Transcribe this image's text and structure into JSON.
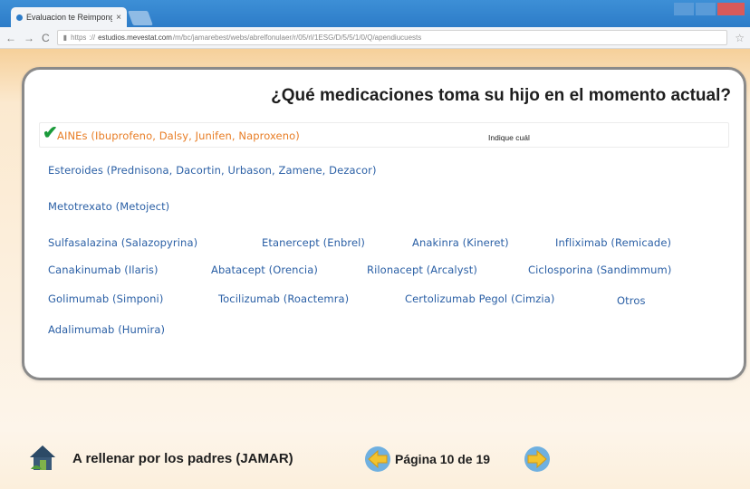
{
  "browser": {
    "tab_title": "Evaluacion te Reimpong",
    "tab_close": "×",
    "nav": {
      "back": "←",
      "forward": "→",
      "reload": "C"
    },
    "url_scheme": "https",
    "url_host": "estudios.mevestat.com",
    "url_path": "/m/bc/jamarebest/webs/abrelfonulaer/r/05/rl/1ESG/D/5/5/1/0/Q/apendiucuests"
  },
  "question": {
    "title": "¿Qué medicaciones toma su hijo en el momento actual?",
    "selected_option": "AINEs (Ibuprofeno, Dalsy, Junifen, Naproxeno)",
    "indique_label": "Indique cuál",
    "options": [
      "Esteroides (Prednisona, Dacortin, Urbason, Zamene, Dezacor)",
      "Metotrexato (Metoject)",
      "Sulfasalazina (Salazopyrina)",
      "Etanercept (Enbrel)",
      "Anakinra (Kineret)",
      "Infliximab (Remicade)",
      "Canakinumab (Ilaris)",
      "Abatacept (Orencia)",
      "Rilonacept (Arcalyst)",
      "Ciclosporina (Sandimmum)",
      "Golimumab (Simponi)",
      "Tocilizumab (Roactemra)",
      "Certolizumab Pegol (Cimzia)",
      "Otros",
      "Adalimumab (Humira)"
    ]
  },
  "footer": {
    "label": "A rellenar por los padres (JAMAR)",
    "page_indicator": "Página 10 de 19",
    "icons": {
      "home": "house-icon",
      "prev": "arrow-left-icon",
      "next": "arrow-right-icon"
    }
  },
  "colors": {
    "accent_selected": "#e87d25",
    "option_text": "#2a5fa5",
    "check": "#1a9a3a",
    "nav_arrow": "#f2c32e",
    "nav_circle": "#6fb0e0"
  }
}
